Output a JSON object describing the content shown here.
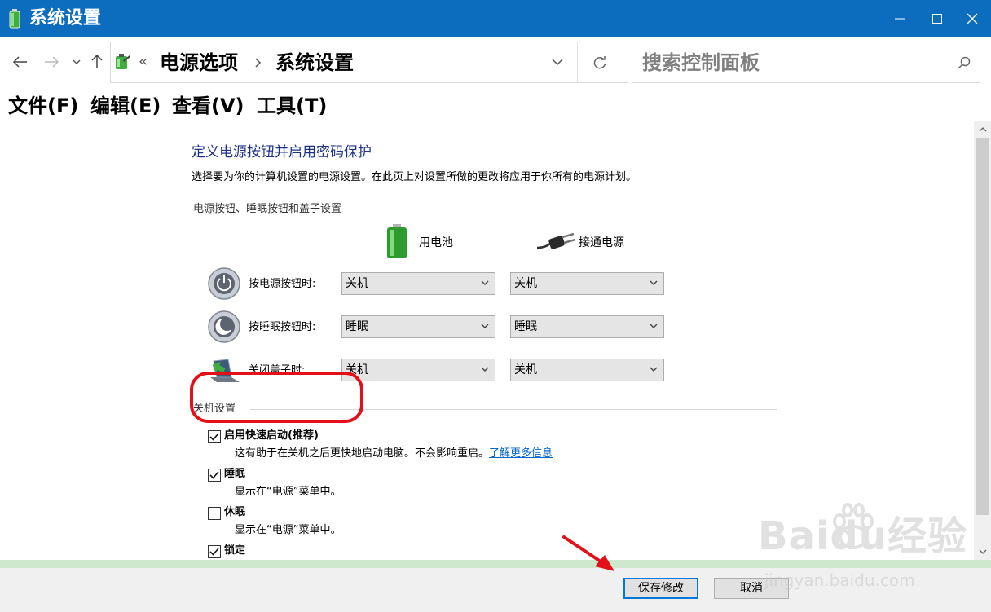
{
  "window": {
    "title": "系统设置",
    "controls": {
      "minimize": "minimize",
      "maximize": "maximize",
      "close": "close"
    }
  },
  "address": {
    "overflow": "«",
    "crumbs": [
      "电源选项",
      "系统设置"
    ],
    "search_placeholder": "搜索控制面板"
  },
  "menu": [
    "文件(F)",
    "编辑(E)",
    "查看(V)",
    "工具(T)"
  ],
  "page": {
    "heading": "定义电源按钮并启用密码保护",
    "description": "选择要为你的计算机设置的电源设置。在此页上对设置所做的更改将应用于你所有的电源计划。",
    "buttons_section": "电源按钮、睡眠按钮和盖子设置",
    "col_battery": "用电池",
    "col_plugged": "接通电源",
    "rows": [
      {
        "label": "按电源按钮时:",
        "battery": "关机",
        "plugged": "关机",
        "icon": "power-button-icon"
      },
      {
        "label": "按睡眠按钮时:",
        "battery": "睡眠",
        "plugged": "睡眠",
        "icon": "sleep-button-icon"
      },
      {
        "label": "关闭盖子时:",
        "battery": "关机",
        "plugged": "关机",
        "icon": "laptop-lid-icon"
      }
    ],
    "shutdown_section": "关机设置",
    "options": [
      {
        "label": "启用快速启动(推荐)",
        "desc": "这有助于在关机之后更快地启动电脑。不会影响重启。",
        "link": "了解更多信息",
        "checked": true
      },
      {
        "label": "睡眠",
        "desc": "显示在“电源”菜单中。",
        "checked": true
      },
      {
        "label": "休眠",
        "desc": "显示在“电源”菜单中。",
        "checked": false
      },
      {
        "label": "锁定",
        "checked": true
      }
    ]
  },
  "footer": {
    "save": "保存修改",
    "cancel": "取消"
  },
  "watermark": {
    "brand": "Baidu经验",
    "url": "jingyan.baidu.com"
  },
  "colors": {
    "titlebar": "#0c6dbf",
    "heading": "#1e3287",
    "link": "#0066cc",
    "highlight": "#e3101a"
  }
}
